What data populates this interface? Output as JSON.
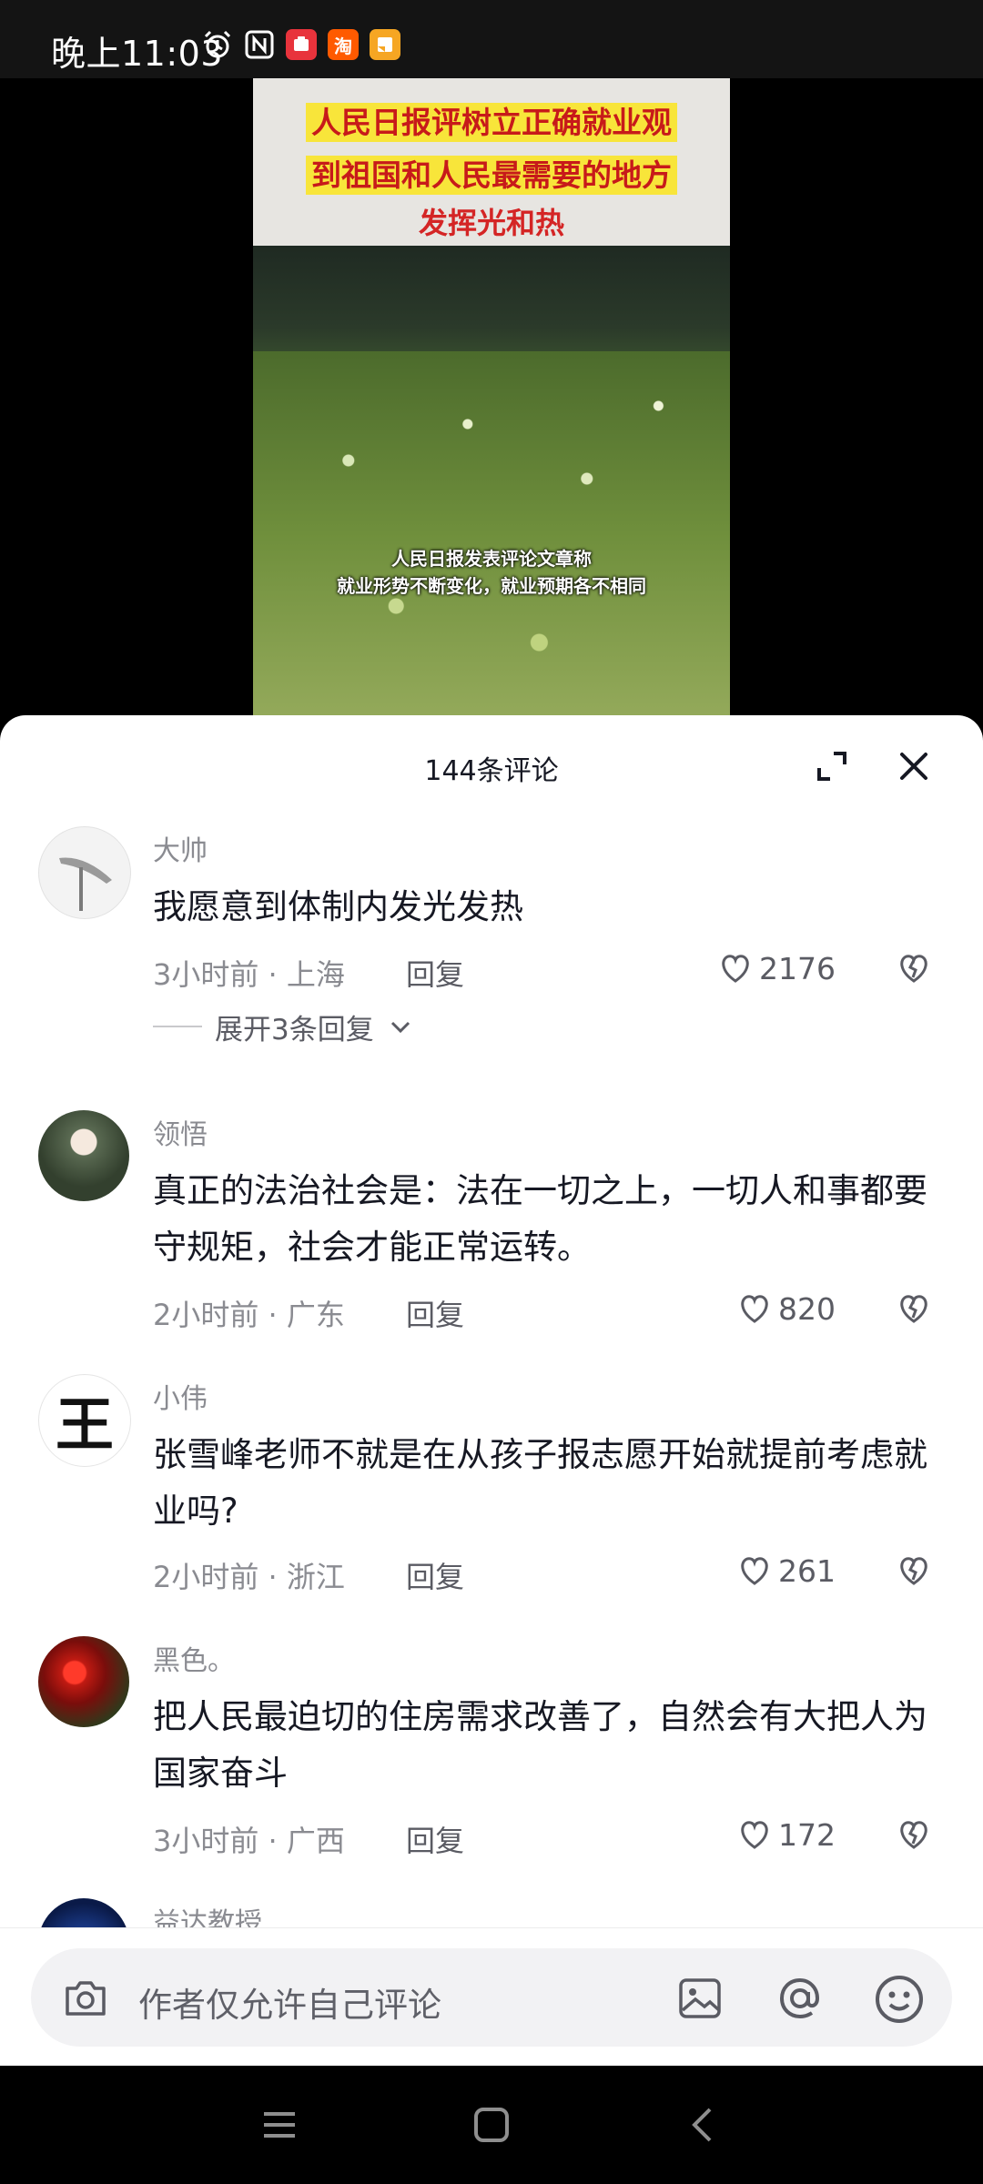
{
  "status_bar": {
    "time": "晚上11:03",
    "icons": [
      "alarm-icon",
      "nfc-icon",
      "app-notification-icon",
      "taobao-icon",
      "note-icon"
    ],
    "taobao_glyph": "淘"
  },
  "video": {
    "headline_line1": "人民日报评树立正确就业观",
    "headline_line2": "到祖国和人民最需要的地方",
    "headline_line3": "发挥光和热",
    "subtitle_line1": "人民日报发表评论文章称",
    "subtitle_line2": "就业形势不断变化，就业预期各不相同"
  },
  "comments_panel": {
    "title": "144条评论",
    "expand_replies_label": "展开3条回复",
    "reply_label": "回复",
    "comments": [
      {
        "name": "大帅",
        "text": "我愿意到体制内发光发热",
        "time": "3小时前",
        "location": "上海",
        "likes": "2176"
      },
      {
        "name": "领悟",
        "text": "真正的法治社会是：法在一切之上，一切人和事都要守规矩，社会才能正常运转。",
        "time": "2小时前",
        "location": "广东",
        "likes": "820"
      },
      {
        "name": "小伟",
        "text": "张雪峰老师不就是在从孩子报志愿开始就提前考虑就业吗?",
        "time": "2小时前",
        "location": "浙江",
        "likes": "261",
        "avatar_char": "王"
      },
      {
        "name": "黑色。",
        "text": "把人民最迫切的住房需求改善了，自然会有大把人为国家奋斗",
        "time": "3小时前",
        "location": "广西",
        "likes": "172"
      },
      {
        "name": "益达教授"
      }
    ]
  },
  "input_bar": {
    "placeholder": "作者仅允许自己评论"
  },
  "nav_bar": {
    "buttons": [
      "menu-icon",
      "home-icon",
      "back-icon"
    ]
  }
}
